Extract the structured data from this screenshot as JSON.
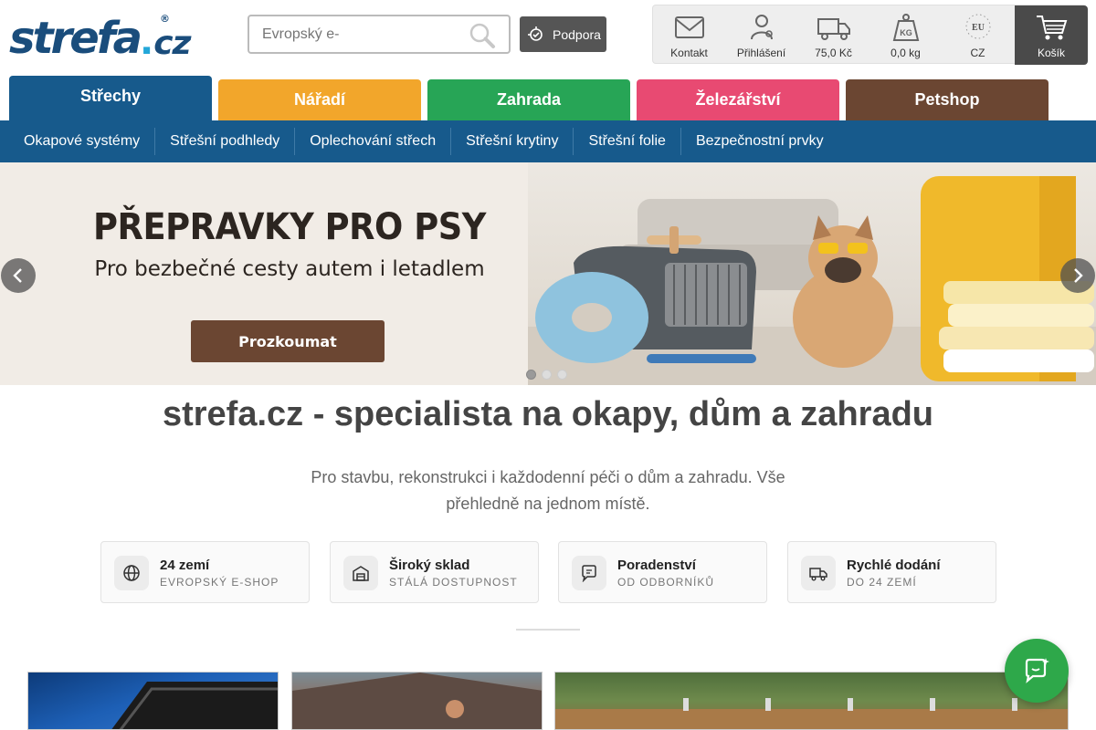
{
  "logo": {
    "main": "strefa",
    "dot": ".",
    "tld": "cz",
    "reg": "®"
  },
  "search": {
    "placeholder": "Evropský e-"
  },
  "support": {
    "label": "Podpora"
  },
  "toolbar": {
    "contact": "Kontakt",
    "login": "Přihlášení",
    "shipping": "75,0 Kč",
    "weight": "0,0 kg",
    "eu_badge": "EU",
    "country": "CZ",
    "cart": "Košík"
  },
  "tabs": [
    {
      "label": "Střechy",
      "color": "#175a8c",
      "active": true
    },
    {
      "label": "Nářadí",
      "color": "#f2a62b",
      "active": false
    },
    {
      "label": "Zahrada",
      "color": "#27a556",
      "active": false
    },
    {
      "label": "Železářství",
      "color": "#e84a72",
      "active": false
    },
    {
      "label": "Petshop",
      "color": "#6b4632",
      "active": false
    }
  ],
  "subnav": [
    "Okapové systémy",
    "Střešní podhledy",
    "Oplechování střech",
    "Střešní krytiny",
    "Střešní folie",
    "Bezpečnostní prvky"
  ],
  "banner": {
    "title": "PŘEPRAVKY PRO PSY",
    "subtitle": "Pro bezbečné cesty autem i letadlem",
    "cta": "Prozkoumat",
    "slide_count": 3,
    "active_slide": 1
  },
  "headline": "strefa.cz - specialista na okapy, dům a zahradu",
  "intro": "Pro stavbu, rekonstrukci i každodenní péči o dům a zahradu. Vše přehledně na jednom místě.",
  "features": [
    {
      "title": "24 zemí",
      "subtitle": "EVROPSKÝ E-SHOP",
      "icon": "globe-icon"
    },
    {
      "title": "Široký sklad",
      "subtitle": "STÁLÁ DOSTUPNOST",
      "icon": "warehouse-icon"
    },
    {
      "title": "Poradenství",
      "subtitle": "OD ODBORNÍKŮ",
      "icon": "chat-icon"
    },
    {
      "title": "Rychlé dodání",
      "subtitle": "DO 24 ZEMÍ",
      "icon": "truck-icon"
    }
  ],
  "colors": {
    "brand_blue": "#175a8c",
    "cta_brown": "#6b4632",
    "chat_green": "#2ea84a"
  }
}
